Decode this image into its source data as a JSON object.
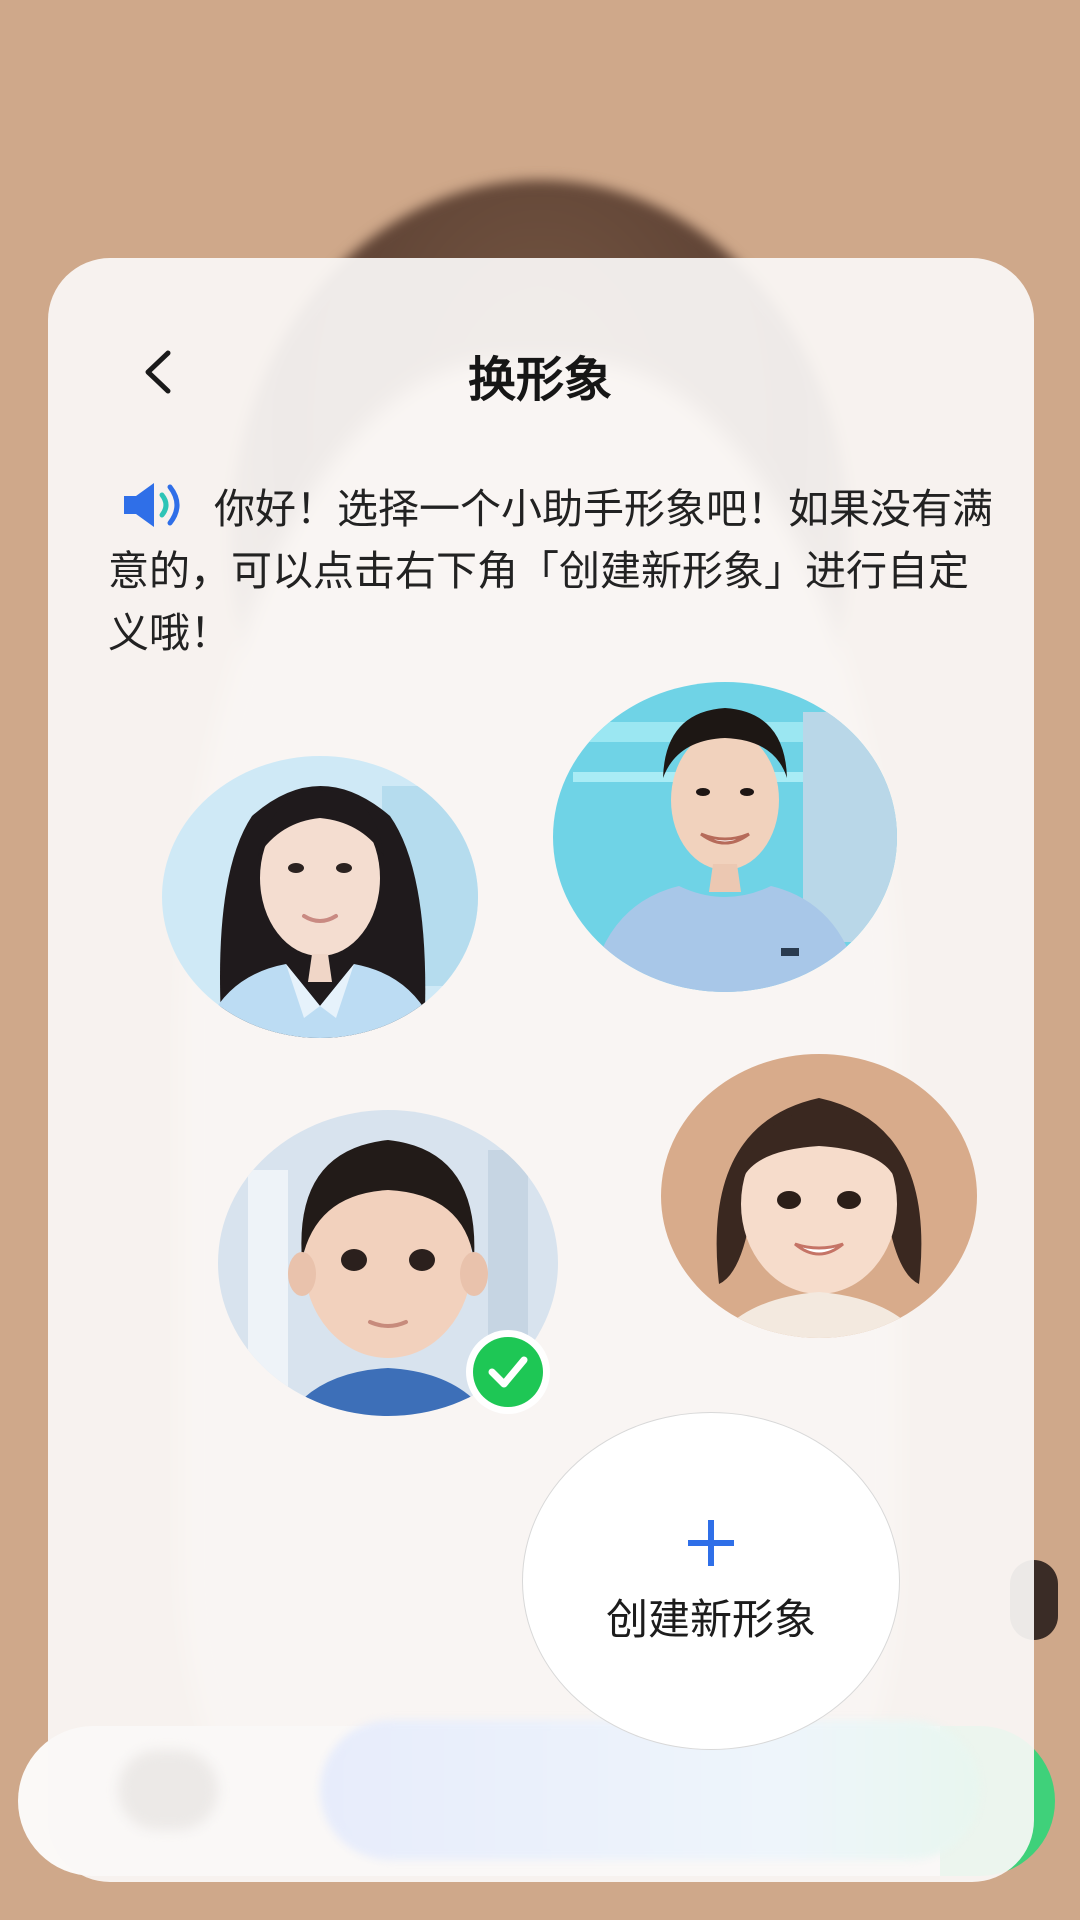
{
  "header": {
    "title": "换形象",
    "back_icon": "chevron-left-icon"
  },
  "intro": {
    "icon": "speaker-icon",
    "text": "你好！选择一个小助手形象吧！如果没有满意的，可以点击右下角「创建新形象」进行自定义哦！"
  },
  "avatars": [
    {
      "name": "young woman",
      "selected": false
    },
    {
      "name": "young man",
      "selected": false
    },
    {
      "name": "little boy",
      "selected": true
    },
    {
      "name": "little girl",
      "selected": false
    }
  ],
  "create": {
    "icon": "plus-icon",
    "label": "创建新形象"
  },
  "colors": {
    "accent_blue": "#2f6fe8",
    "selected_green": "#1ec755",
    "bottom_green": "#3fd17a"
  }
}
